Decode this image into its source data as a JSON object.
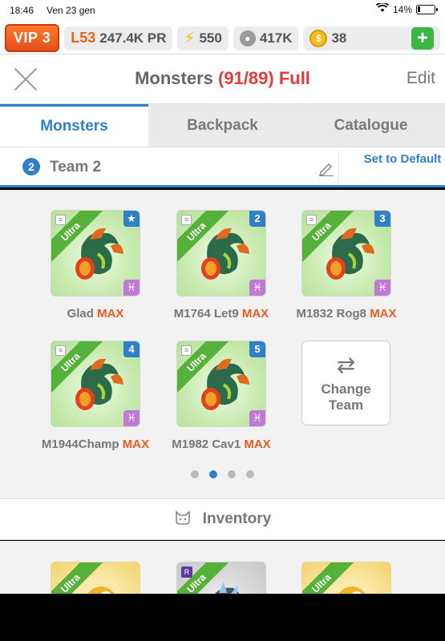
{
  "status_bar": {
    "time": "18:46",
    "date": "Ven 23 gen",
    "battery": "14%"
  },
  "resources": {
    "vip": "VIP 3",
    "level": "L53",
    "power": "247.4K PR",
    "energy": "550",
    "food": "417K",
    "gold": "38"
  },
  "header": {
    "title": "Monsters",
    "count": "(91/89) Full",
    "edit": "Edit"
  },
  "tabs": [
    {
      "label": "Monsters",
      "active": true
    },
    {
      "label": "Backpack",
      "active": false
    },
    {
      "label": "Catalogue",
      "active": false
    }
  ],
  "team": {
    "number": "2",
    "name": "Team 2",
    "set_default": "Set to Default"
  },
  "team_monsters": [
    {
      "rarity": "Ultra",
      "position": "★",
      "name": "Glad",
      "max": "MAX"
    },
    {
      "rarity": "Ultra",
      "position": "2",
      "name": "M1764 Let9",
      "max": "MAX"
    },
    {
      "rarity": "Ultra",
      "position": "3",
      "name": "M1832 Rog8",
      "max": "MAX"
    },
    {
      "rarity": "Ultra",
      "position": "4",
      "name": "M1944Champ",
      "max": "MAX"
    },
    {
      "rarity": "Ultra",
      "position": "5",
      "name": "M1982 Cav1",
      "max": "MAX"
    }
  ],
  "change_team": {
    "arrows": "⇄",
    "label": "Change Team"
  },
  "pagination": {
    "pages": 4,
    "active": 2
  },
  "inventory": {
    "label": "Inventory",
    "items": [
      {
        "rarity": "Ultra"
      },
      {
        "rarity": "Ultra",
        "badge": "R"
      },
      {
        "rarity": "Ultra"
      }
    ]
  },
  "colors": {
    "accent": "#2f7fc9",
    "max": "#ea5b1f",
    "full": "#e23b3b",
    "vip": "#e8641c"
  }
}
